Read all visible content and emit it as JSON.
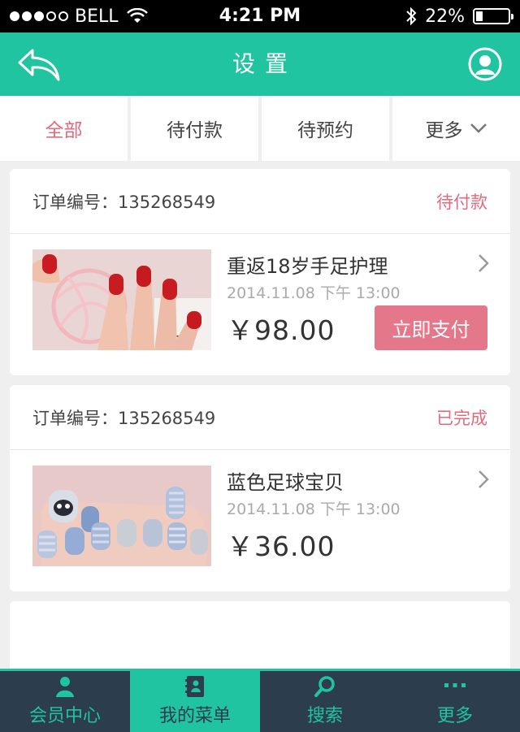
{
  "status_bar": {
    "carrier": "BELL",
    "time": "4:21 PM",
    "battery_text": "22%",
    "battery_level": 0.22,
    "signal_bars_filled": 3,
    "signal_bars_total": 5
  },
  "nav": {
    "title": "设置",
    "back_icon": "back-arrow-icon",
    "user_icon": "user-icon"
  },
  "tabs": [
    {
      "label": "全部",
      "active": true
    },
    {
      "label": "待付款",
      "active": false
    },
    {
      "label": "待预约",
      "active": false
    },
    {
      "label": "更多",
      "active": false,
      "icon": "chevron-down-icon"
    }
  ],
  "orders": [
    {
      "order_label": "订单编号：135268549",
      "status": "待付款",
      "product_name": "重返18岁手足护理",
      "datetime": "2014.11.08  下午 13:00",
      "price": "￥98.00",
      "action_label": "立即支付"
    },
    {
      "order_label": "订单编号：135268549",
      "status": "已完成",
      "product_name": "蓝色足球宝贝",
      "datetime": "2014.11.08  下午 13:00",
      "price": "￥36.00"
    }
  ],
  "tabbar": [
    {
      "label": "会员中心",
      "icon": "user-icon",
      "active": false
    },
    {
      "label": "我的菜单",
      "icon": "notebook-icon",
      "active": true
    },
    {
      "label": "搜索",
      "icon": "search-icon",
      "active": false
    },
    {
      "label": "更多",
      "icon": "more-dots-icon",
      "active": false
    }
  ],
  "colors": {
    "brand": "#20c4a1",
    "accent": "#e4697e",
    "tabbar_bg": "#2c3d4d",
    "pay_button": "#e4788a"
  }
}
